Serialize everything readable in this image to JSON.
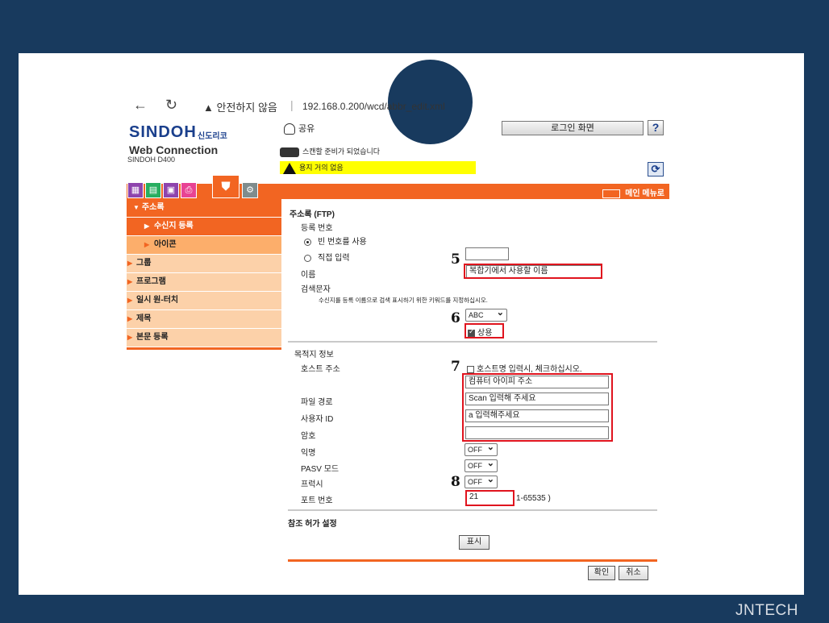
{
  "browser": {
    "security": "안전하지 않음",
    "url": "192.168.0.200/wcd/abbr_edit.xml"
  },
  "header": {
    "logo": "SINDOH",
    "logo_sub": "신도리코",
    "product": "Web Connection",
    "model": "SINDOH D400",
    "user": "공유",
    "login_button": "로그인 화면",
    "help": "?",
    "status_scan": "스캔할 준비가 되었습니다",
    "status_warning": "용지 거의 없음",
    "main_menu": "메인 메뉴로"
  },
  "sidebar": {
    "items": [
      {
        "label": "주소록"
      },
      {
        "label": "수신지 등록"
      },
      {
        "label": "아이콘"
      },
      {
        "label": "그룹"
      },
      {
        "label": "프로그램"
      },
      {
        "label": "일시 원-터치"
      },
      {
        "label": "제목"
      },
      {
        "label": "본문 등록"
      }
    ]
  },
  "form": {
    "title": "주소록 (FTP)",
    "reg_number": "등록 번호",
    "use_empty": "빈 번호를 사용",
    "direct_input": "직접 입력",
    "name_label": "이름",
    "name_value": "복합기에서 사용할 이름",
    "search_label": "검색문자",
    "search_help": "수신지를 등록 이름으로 검색 표시하기 위한 키워드를 지정하십시오.",
    "search_select": "ABC",
    "common_label": "상용",
    "dest_section": "목적지 정보",
    "host_label": "호스트 주소",
    "host_check": "호스트명 입력시, 체크하십시오.",
    "host_value": "컴퓨터 아이피 주소",
    "path_label": "파일 경로",
    "path_value": "Scan 입력해 주세요",
    "userid_label": "사용자 ID",
    "userid_value": "a 입력해주세요",
    "password_label": "암호",
    "password_value": "",
    "anon_label": "익명",
    "anon_value": "OFF",
    "pasv_label": "PASV 모드",
    "pasv_value": "OFF",
    "proxy_label": "프럭시",
    "proxy_value": "OFF",
    "port_label": "포트 번호",
    "port_value": "21",
    "port_range": "1-65535 )",
    "ref_section": "참조 허가 설정",
    "show_button": "표시",
    "ok_button": "확인",
    "cancel_button": "취소"
  },
  "annotations": {
    "step5": "5",
    "step6": "6",
    "step7": "7",
    "step8": "8"
  },
  "footer": {
    "brand": "JNTECH"
  },
  "colors": {
    "background": "#183a5e",
    "accent": "#f26522",
    "highlight": "#e0141e"
  }
}
